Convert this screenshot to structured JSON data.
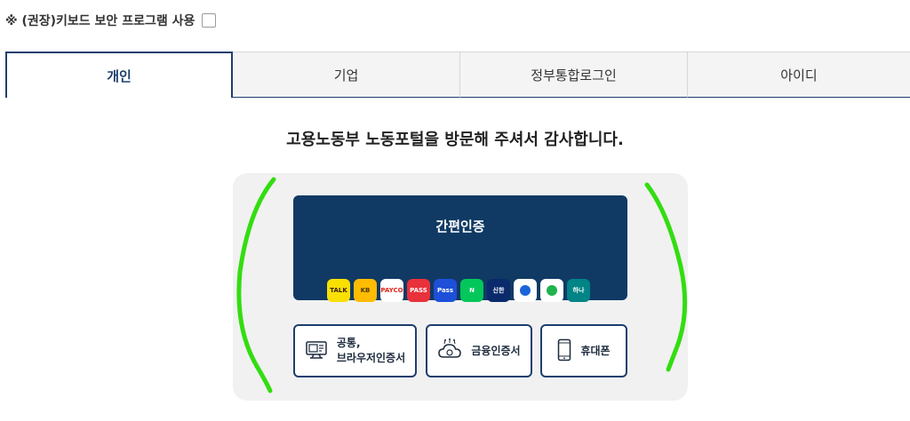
{
  "keyboard_security": {
    "label": "※ (권장)키보드 보안 프로그램 사용",
    "checked": false
  },
  "tabs": [
    {
      "label": "개인",
      "active": true
    },
    {
      "label": "기업",
      "active": false
    },
    {
      "label": "정부통합로그인",
      "active": false
    },
    {
      "label": "아이디",
      "active": false
    }
  ],
  "welcome_message": "고용노동부 노동포털을 방문해 주셔서 감사합니다.",
  "simple_auth": {
    "title": "간편인증",
    "apps": [
      {
        "name": "kakao-talk-icon",
        "text": "TALK",
        "bg": "#f9e000",
        "fg": "#3a1d1d"
      },
      {
        "name": "kb-icon",
        "text": "KB",
        "bg": "#ffbc00",
        "fg": "#4a3b10"
      },
      {
        "name": "payco-icon",
        "text": "PAYCO",
        "bg": "#ffffff",
        "fg": "#e2231a"
      },
      {
        "name": "pass-icon",
        "text": "PASS",
        "bg": "#e8313b",
        "fg": "#ffffff"
      },
      {
        "name": "samsung-pass-icon",
        "text": "Pass",
        "bg": "#1d4fd8",
        "fg": "#ffffff"
      },
      {
        "name": "naver-icon",
        "text": "N",
        "bg": "#03c75a",
        "fg": "#ffffff"
      },
      {
        "name": "shinhan-icon",
        "text": "신한",
        "bg": "#0a2a6b",
        "fg": "#ffffff"
      },
      {
        "name": "toss-icon",
        "text": "",
        "bg": "#ffffff",
        "fg": "#1b64da"
      },
      {
        "name": "bank-salad-icon",
        "text": "",
        "bg": "#ffffff",
        "fg": "#1fb34d"
      },
      {
        "name": "hana-icon",
        "text": "하나",
        "bg": "#008485",
        "fg": "#ffffff"
      }
    ]
  },
  "buttons": {
    "cert_line1": "공통,",
    "cert_line2": "브라우저인증서",
    "financial": "금융인증서",
    "phone": "휴대폰"
  },
  "colors": {
    "accent": "#1d3f6e",
    "panel_bg": "#103a64",
    "annotation": "#33dd11"
  }
}
